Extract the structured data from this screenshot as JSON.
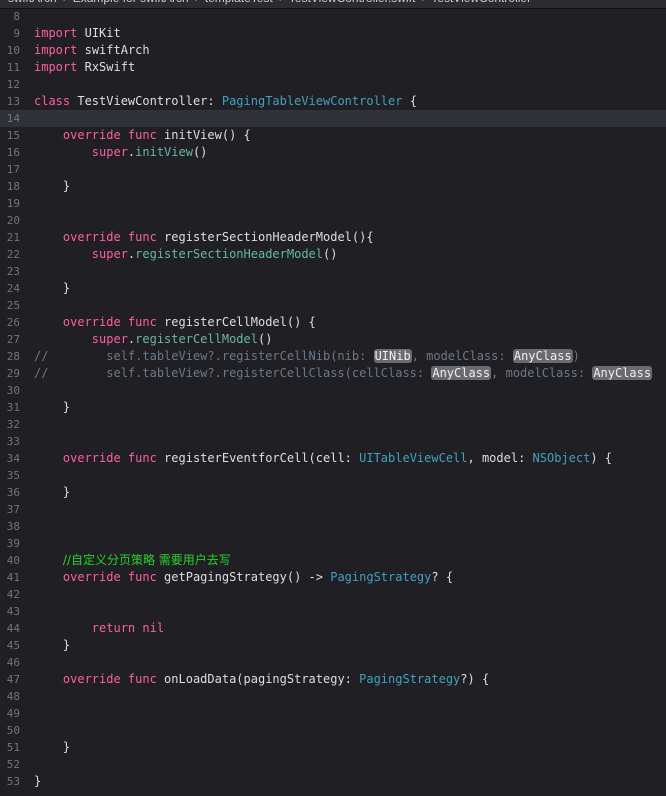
{
  "breadcrumb": [
    "swiftArch",
    "Example for swiftArch",
    "templateTest",
    "TestViewController.swift",
    "TestViewController"
  ],
  "current_line": 14,
  "colors": {
    "keyword": "#fc5fa3",
    "type": "#5dd8ff",
    "comment": "#6c7986",
    "zh_comment": "#2bd12b",
    "placeholder_bg": "#6b6b6f"
  },
  "lines": [
    {
      "n": 8,
      "t": []
    },
    {
      "n": 9,
      "t": [
        [
          "kw",
          "import"
        ],
        [
          "",
          "UIKit"
        ]
      ]
    },
    {
      "n": 10,
      "t": [
        [
          "kw",
          "import"
        ],
        [
          "",
          "swiftArch"
        ]
      ]
    },
    {
      "n": 11,
      "t": [
        [
          "kw",
          "import"
        ],
        [
          "",
          "RxSwift"
        ]
      ]
    },
    {
      "n": 12,
      "t": []
    },
    {
      "n": 13,
      "t": [
        [
          "kw",
          "class"
        ],
        [
          "",
          "TestViewController: "
        ],
        [
          "ty2",
          "PagingTableViewController"
        ],
        [
          "",
          " {"
        ]
      ]
    },
    {
      "n": 14,
      "t": []
    },
    {
      "n": 15,
      "t": [
        [
          "",
          "    "
        ],
        [
          "kw",
          "override func"
        ],
        [
          "",
          " initView() {"
        ]
      ]
    },
    {
      "n": 16,
      "t": [
        [
          "",
          "        "
        ],
        [
          "kw",
          "super"
        ],
        [
          "",
          "."
        ],
        [
          "fn",
          "initView"
        ],
        [
          "",
          "()"
        ]
      ]
    },
    {
      "n": 17,
      "t": []
    },
    {
      "n": 18,
      "t": [
        [
          "",
          "    }"
        ]
      ]
    },
    {
      "n": 19,
      "t": []
    },
    {
      "n": 20,
      "t": []
    },
    {
      "n": 21,
      "t": [
        [
          "",
          "    "
        ],
        [
          "kw",
          "override func"
        ],
        [
          "",
          " registerSectionHeaderModel(){"
        ]
      ]
    },
    {
      "n": 22,
      "t": [
        [
          "",
          "        "
        ],
        [
          "kw",
          "super"
        ],
        [
          "",
          "."
        ],
        [
          "fn",
          "registerSectionHeaderModel"
        ],
        [
          "",
          "()"
        ]
      ]
    },
    {
      "n": 23,
      "t": []
    },
    {
      "n": 24,
      "t": [
        [
          "",
          "    }"
        ]
      ]
    },
    {
      "n": 25,
      "t": []
    },
    {
      "n": 26,
      "t": [
        [
          "",
          "    "
        ],
        [
          "kw",
          "override func"
        ],
        [
          "",
          " registerCellModel() {"
        ]
      ]
    },
    {
      "n": 27,
      "t": [
        [
          "",
          "        "
        ],
        [
          "kw",
          "super"
        ],
        [
          "",
          "."
        ],
        [
          "fn",
          "registerCellModel"
        ],
        [
          "",
          "()"
        ]
      ]
    },
    {
      "n": 28,
      "t": [
        [
          "cm",
          "//        self.tableView?.registerCellNib(nib: "
        ],
        [
          "ph",
          "UINib"
        ],
        [
          "cm",
          ", modelClass: "
        ],
        [
          "ph",
          "AnyClass"
        ],
        [
          "cm",
          ")"
        ]
      ]
    },
    {
      "n": 29,
      "t": [
        [
          "cm",
          "//        self.tableView?.registerCellClass(cellClass: "
        ],
        [
          "ph",
          "AnyClass"
        ],
        [
          "cm",
          ", modelClass: "
        ],
        [
          "ph",
          "AnyClass"
        ]
      ]
    },
    {
      "n": 30,
      "t": []
    },
    {
      "n": 31,
      "t": [
        [
          "",
          "    }"
        ]
      ]
    },
    {
      "n": 32,
      "t": []
    },
    {
      "n": 33,
      "t": []
    },
    {
      "n": 34,
      "t": [
        [
          "",
          "    "
        ],
        [
          "kw",
          "override func"
        ],
        [
          "",
          " registerEventforCell(cell: "
        ],
        [
          "ty2",
          "UITableViewCell"
        ],
        [
          "",
          ", model: "
        ],
        [
          "ty2",
          "NSObject"
        ],
        [
          "",
          ") {"
        ]
      ]
    },
    {
      "n": 35,
      "t": []
    },
    {
      "n": 36,
      "t": [
        [
          "",
          "    }"
        ]
      ]
    },
    {
      "n": 37,
      "t": []
    },
    {
      "n": 38,
      "t": []
    },
    {
      "n": 39,
      "t": []
    },
    {
      "n": 40,
      "t": [
        [
          "",
          "    "
        ],
        [
          "cm-zh",
          "//自定义分页策略 需要用户去写"
        ]
      ]
    },
    {
      "n": 41,
      "t": [
        [
          "",
          "    "
        ],
        [
          "kw",
          "override func"
        ],
        [
          "",
          " getPagingStrategy() -> "
        ],
        [
          "ty2",
          "PagingStrategy"
        ],
        [
          "",
          "? {"
        ]
      ]
    },
    {
      "n": 42,
      "t": []
    },
    {
      "n": 43,
      "t": []
    },
    {
      "n": 44,
      "t": [
        [
          "",
          "        "
        ],
        [
          "kw",
          "return nil"
        ]
      ]
    },
    {
      "n": 45,
      "t": [
        [
          "",
          "    }"
        ]
      ]
    },
    {
      "n": 46,
      "t": []
    },
    {
      "n": 47,
      "t": [
        [
          "",
          "    "
        ],
        [
          "kw",
          "override func"
        ],
        [
          "",
          " onLoadData(pagingStrategy: "
        ],
        [
          "ty2",
          "PagingStrategy"
        ],
        [
          "",
          "?) {"
        ]
      ]
    },
    {
      "n": 48,
      "t": []
    },
    {
      "n": 49,
      "t": []
    },
    {
      "n": 50,
      "t": []
    },
    {
      "n": 51,
      "t": [
        [
          "",
          "    }"
        ]
      ]
    },
    {
      "n": 52,
      "t": []
    },
    {
      "n": 53,
      "t": [
        [
          "",
          "}"
        ]
      ]
    }
  ]
}
